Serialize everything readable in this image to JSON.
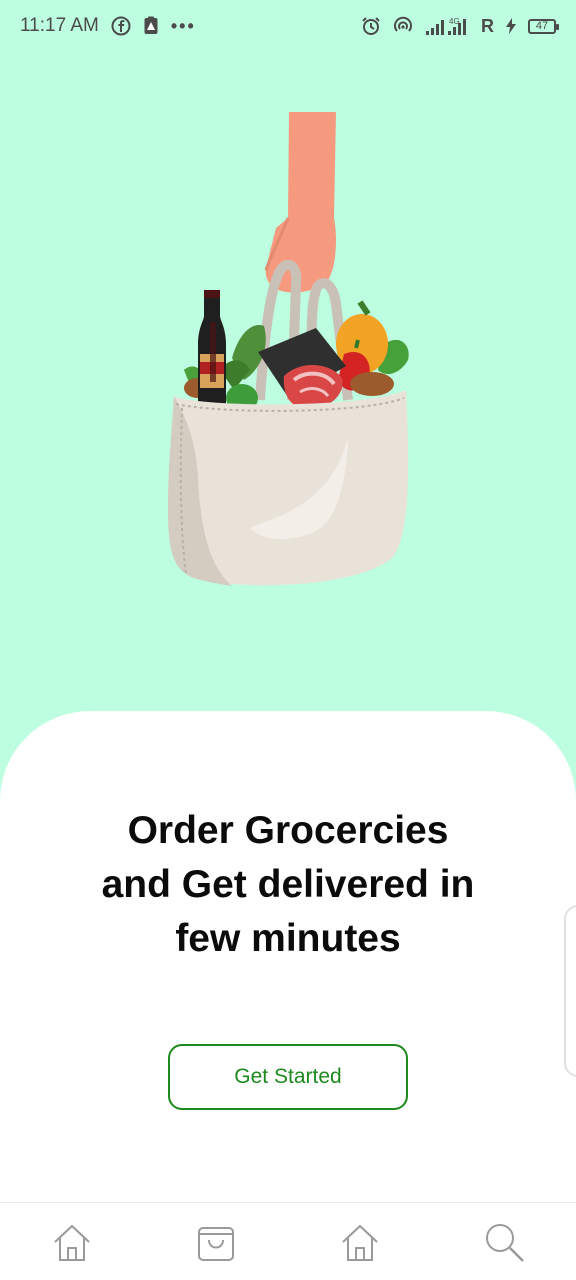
{
  "status_bar": {
    "time": "11:17 AM",
    "dots": "•••",
    "network_gen": "4G",
    "roaming": "R",
    "battery": "47",
    "icons": [
      "facebook-icon",
      "notification-icon",
      "alarm-icon",
      "hotspot-icon",
      "signal-icon",
      "charging-icon"
    ]
  },
  "hero": {
    "illustration": "grocery-bag-illustration"
  },
  "main": {
    "headline_lines": [
      "Order Grocercies",
      "and Get delivered in",
      "few minutes"
    ],
    "cta_label": "Get Started"
  },
  "bottom_nav": {
    "items": [
      {
        "icon": "home-icon"
      },
      {
        "icon": "shopping-bag-icon"
      },
      {
        "icon": "home-icon"
      },
      {
        "icon": "search-icon"
      }
    ]
  },
  "colors": {
    "background": "#bdfde0",
    "accent": "#1e8a1e",
    "card": "#ffffff",
    "headline": "#0b0b0b"
  }
}
